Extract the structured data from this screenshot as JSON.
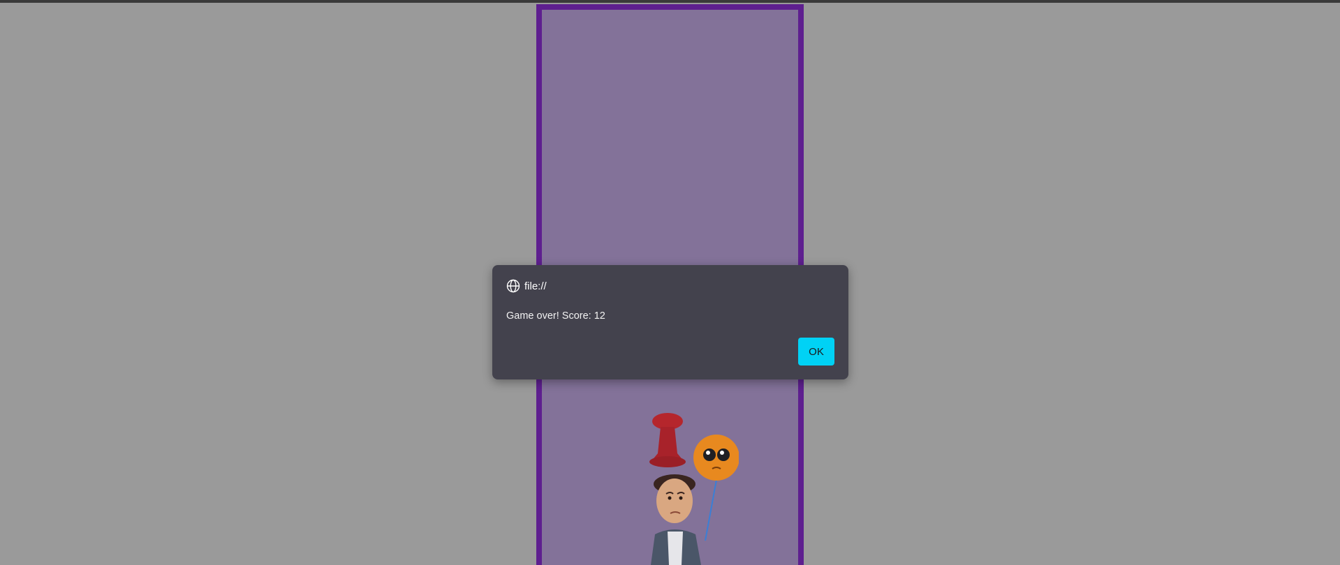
{
  "dialog": {
    "origin": "file://",
    "message": "Game over! Score: 12",
    "ok_label": "OK"
  },
  "game": {
    "score": 12
  },
  "colors": {
    "page_bg": "#9a9a9a",
    "frame_border": "#5e1f8f",
    "frame_bg": "#837299",
    "dialog_bg": "#43424d",
    "ok_button": "#00d2f5",
    "balloon_orange": "#e8891f",
    "buoy_red": "#b5262c"
  },
  "icons": {
    "origin_icon": "globe-icon"
  }
}
